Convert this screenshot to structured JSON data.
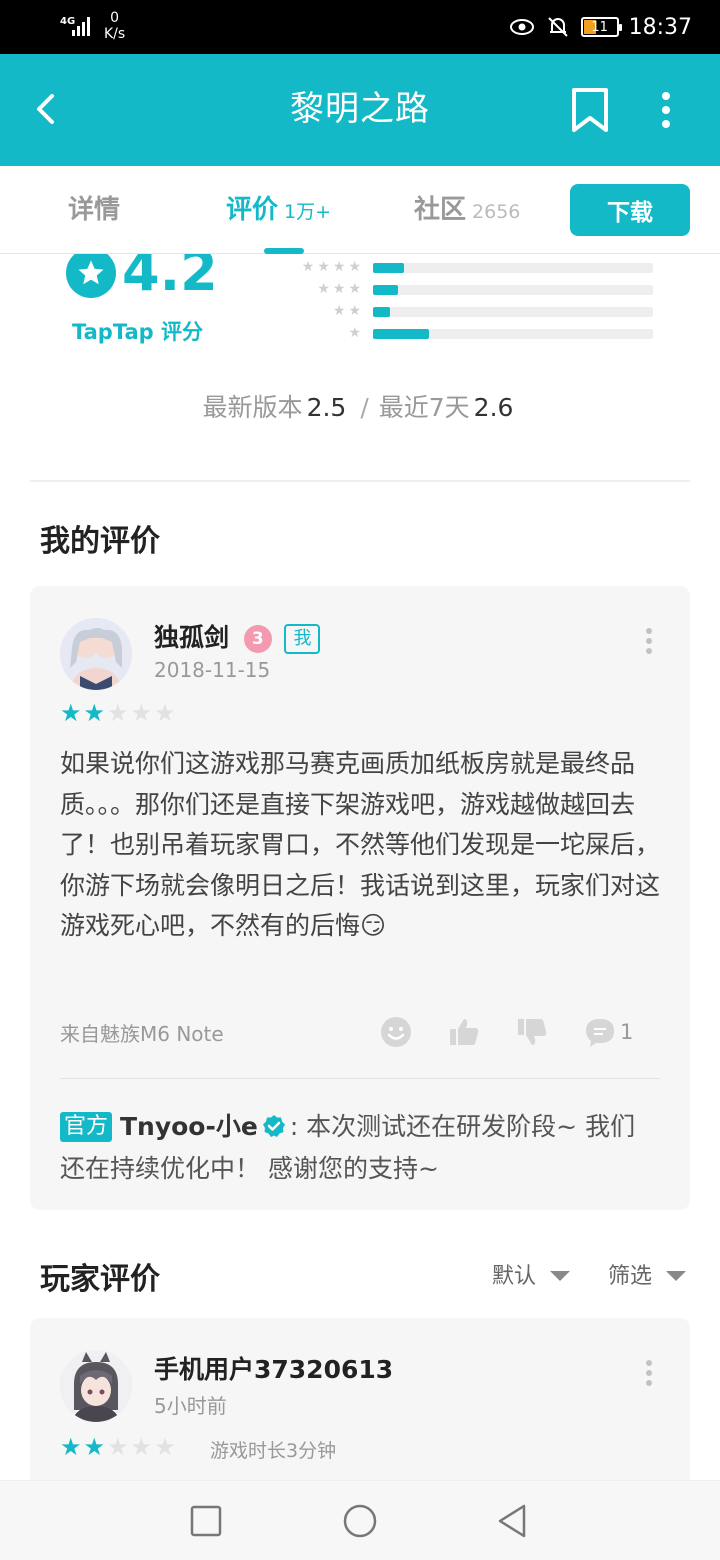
{
  "status_bar": {
    "network": "4G",
    "speed_value": "0",
    "speed_unit": "K/s",
    "battery": "11",
    "time": "18:37"
  },
  "app_bar": {
    "title": "黎明之路"
  },
  "tabs": [
    {
      "label": "详情",
      "count": ""
    },
    {
      "label": "评价",
      "count": "1万+"
    },
    {
      "label": "社区",
      "count": "2656"
    }
  ],
  "download_label": "下载",
  "rating": {
    "score": "4.2",
    "label": "TapTap 评分",
    "distribution": [
      {
        "stars": "★★★★",
        "fraction": 0.11
      },
      {
        "stars": "★★★",
        "fraction": 0.09
      },
      {
        "stars": "★★",
        "fraction": 0.06
      },
      {
        "stars": "★",
        "fraction": 0.2
      }
    ],
    "latest_label": "最新版本",
    "latest_value": "2.5",
    "separator": "/",
    "recent_label": "最近7天",
    "recent_value": "2.6"
  },
  "my_review": {
    "section_title": "我的评价",
    "user": "独孤剑",
    "me_badge": "我",
    "level_badge": "3",
    "date": "2018-11-15",
    "stars": 2,
    "text": "如果说你们这游戏那马赛克画质加纸板房就是最终品质。。。那你们还是直接下架游戏吧，游戏越做越回去了！也别吊着玩家胃口，不然等他们发现是一坨屎后，你游下场就会像明日之后！我话说到这里，玩家们对这游戏死心吧，不然有的后悔😏",
    "device": "来自魅族M6 Note",
    "reply_count": "1",
    "official_badge": "官方",
    "official_name": "Tnyoo-小e",
    "official_reply": ": 本次测试还在研发阶段~ 我们还在持续优化中！ 感谢您的支持~"
  },
  "player_reviews": {
    "section_title": "玩家评价",
    "sort_label": "默认",
    "filter_label": "筛选",
    "items": [
      {
        "user": "手机用户37320613",
        "time": "5小时前",
        "stars": 2,
        "playtime": "游戏时长3分钟"
      }
    ]
  },
  "colors": {
    "accent": "#14b9c8",
    "status_bar": "#000000"
  },
  "icons": [
    "back-icon",
    "bookmark-icon",
    "more-icon",
    "emoji-icon",
    "thumbs-up-icon",
    "thumbs-down-icon",
    "comment-icon",
    "verified-icon"
  ]
}
